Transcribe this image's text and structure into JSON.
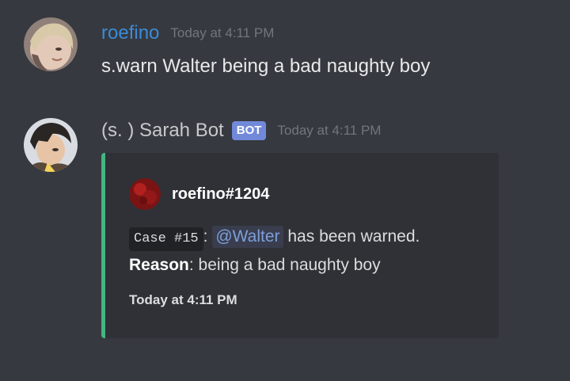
{
  "messages": [
    {
      "author": "roefino",
      "timestamp": "Today at 4:11 PM",
      "content": "s.warn Walter being a bad naughty boy",
      "avatar_icon": "anime-character-avatar"
    },
    {
      "author": "(s. ) Sarah Bot",
      "bot_tag": "BOT",
      "timestamp": "Today at 4:11 PM",
      "avatar_icon": "anime-character-avatar",
      "embed": {
        "color": "#43b581",
        "author_name": "roefino#1204",
        "author_icon": "red-circle-avatar",
        "case_code": "Case #15",
        "case_sep": ":",
        "mention": "@Walter",
        "warn_text": "has been warned.",
        "reason_label": "Reason",
        "reason_sep": ":",
        "reason_text": "being a bad naughty boy",
        "footer": "Today at 4:11 PM"
      }
    }
  ],
  "colors": {
    "background": "#36393f",
    "embed_background": "#2f3136",
    "user_name": "#3b8bd6",
    "bot_tag": "#7289da",
    "mention": "#7d9fd9",
    "timestamp": "#72767d"
  }
}
